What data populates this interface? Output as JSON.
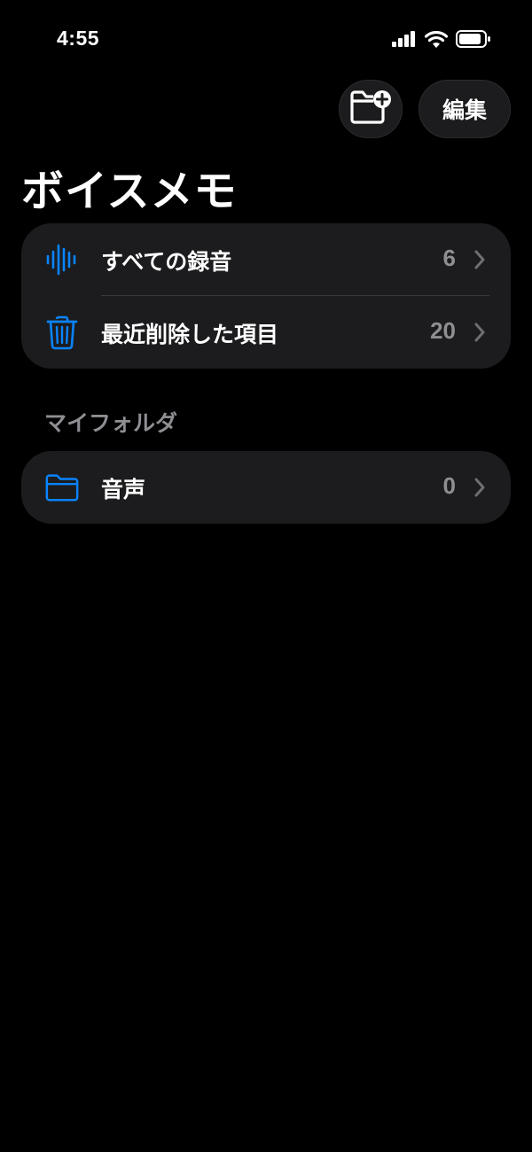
{
  "status_bar": {
    "time": "4:55",
    "icons": [
      "cellular-signal-icon",
      "wifi-icon",
      "battery-icon"
    ]
  },
  "toolbar": {
    "new_folder_icon": "folder-plus-icon",
    "edit_label": "編集"
  },
  "page": {
    "title": "ボイスメモ"
  },
  "library": {
    "items": [
      {
        "label": "すべての録音",
        "count": "6",
        "icon": "waveform-icon"
      },
      {
        "label": "最近削除した項目",
        "count": "20",
        "icon": "trash-icon"
      }
    ]
  },
  "folders": {
    "header": "マイフォルダ",
    "items": [
      {
        "label": "音声",
        "count": "0",
        "icon": "folder-icon"
      }
    ]
  },
  "colors": {
    "background": "#000000",
    "card": "#1c1c1e",
    "accent": "#0a84ff",
    "secondary_text": "#8e8e93"
  }
}
